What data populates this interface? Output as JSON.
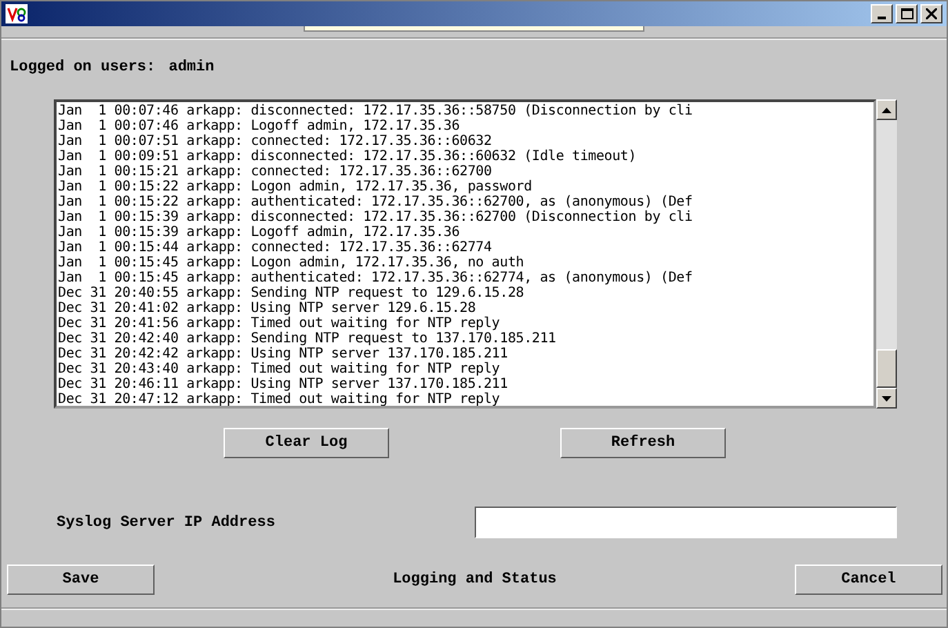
{
  "logged_on": {
    "label": "Logged on users:",
    "value": "admin"
  },
  "log_lines": [
    "Jan  1 00:07:46 arkapp: disconnected: 172.17.35.36::58750 (Disconnection by cli",
    "Jan  1 00:07:46 arkapp: Logoff admin, 172.17.35.36",
    "Jan  1 00:07:51 arkapp: connected: 172.17.35.36::60632",
    "Jan  1 00:09:51 arkapp: disconnected: 172.17.35.36::60632 (Idle timeout)",
    "Jan  1 00:15:21 arkapp: connected: 172.17.35.36::62700",
    "Jan  1 00:15:22 arkapp: Logon admin, 172.17.35.36, password",
    "Jan  1 00:15:22 arkapp: authenticated: 172.17.35.36::62700, as (anonymous) (Def",
    "Jan  1 00:15:39 arkapp: disconnected: 172.17.35.36::62700 (Disconnection by cli",
    "Jan  1 00:15:39 arkapp: Logoff admin, 172.17.35.36",
    "Jan  1 00:15:44 arkapp: connected: 172.17.35.36::62774",
    "Jan  1 00:15:45 arkapp: Logon admin, 172.17.35.36, no auth",
    "Jan  1 00:15:45 arkapp: authenticated: 172.17.35.36::62774, as (anonymous) (Def",
    "Dec 31 20:40:55 arkapp: Sending NTP request to 129.6.15.28",
    "Dec 31 20:41:02 arkapp: Using NTP server 129.6.15.28",
    "Dec 31 20:41:56 arkapp: Timed out waiting for NTP reply",
    "Dec 31 20:42:40 arkapp: Sending NTP request to 137.170.185.211",
    "Dec 31 20:42:42 arkapp: Using NTP server 137.170.185.211",
    "Dec 31 20:43:40 arkapp: Timed out waiting for NTP reply",
    "Dec 31 20:46:11 arkapp: Using NTP server 137.170.185.211",
    "Dec 31 20:47:12 arkapp: Timed out waiting for NTP reply"
  ],
  "log_buttons": [
    "Clear Log",
    "Refresh"
  ],
  "syslog": {
    "label": "Syslog Server IP Address"
  },
  "footer": {
    "save": "Save",
    "title": "Logging and Status",
    "cancel": "Cancel"
  }
}
